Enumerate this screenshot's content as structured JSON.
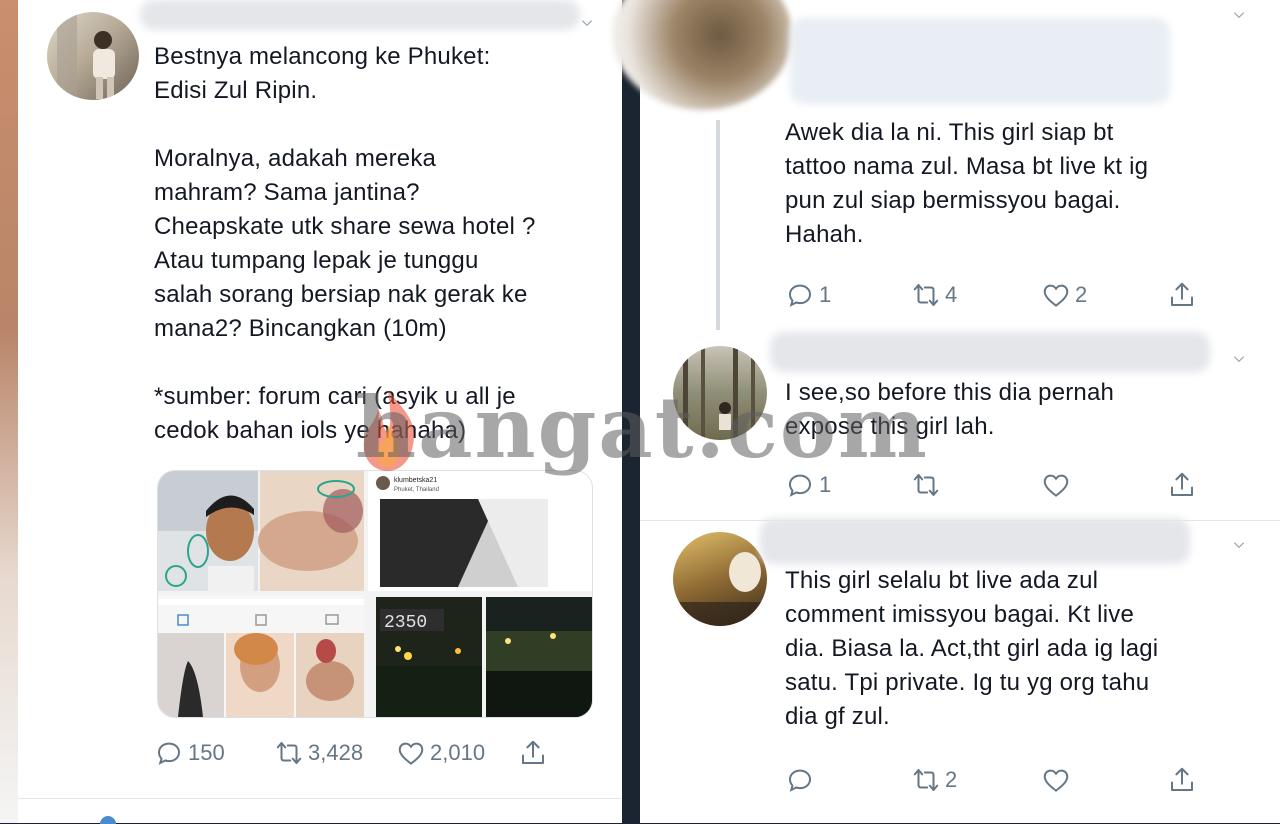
{
  "left_tweet": {
    "text": "Bestnya melancong ke Phuket:\nEdisi Zul Ripin.\n\nMoralnya, adakah mereka\nmahram? Sama jantina?\nCheapskate utk share sewa hotel ?\nAtau tumpang lepak je tunggu\nsalah sorang bersiap nak gerak ke\nmana2?  Bincangkan (10m)\n\n*sumber: forum cari (asyik u all je\ncedok bahan iols ye hahaha)",
    "media": {
      "ig_username": "klumbetska21",
      "ig_location": "Phuket, Thailand",
      "counter": "2350"
    },
    "replies": "150",
    "retweets": "3,428",
    "likes": "2,010"
  },
  "right_tweets": [
    {
      "text": "Awek dia la ni. This girl siap bt\ntattoo nama zul. Masa bt live kt ig\npun zul siap bermissyou bagai.\nHahah.",
      "replies": "1",
      "retweets": "4",
      "likes": "2"
    },
    {
      "text": "I see,so before this dia pernah\nexpose this girl lah.",
      "replies": "1",
      "retweets": "",
      "likes": ""
    },
    {
      "text": "This girl selalu bt live ada zul\ncomment imissyou bagai. Kt live\ndia. Biasa la. Act,tht girl ada ig lagi\nsatu. Tpi private. Ig tu yg org tahu\ndia gf zul.",
      "replies": "",
      "retweets": "2",
      "likes": ""
    }
  ],
  "watermark": {
    "text": "hangat.com"
  },
  "colors": {
    "icon_gray": "#657786",
    "text": "#141823",
    "dark_bg": "#1b2431"
  },
  "icons": [
    "reply-icon",
    "retweet-icon",
    "like-icon",
    "share-icon",
    "chevron-down-icon"
  ]
}
